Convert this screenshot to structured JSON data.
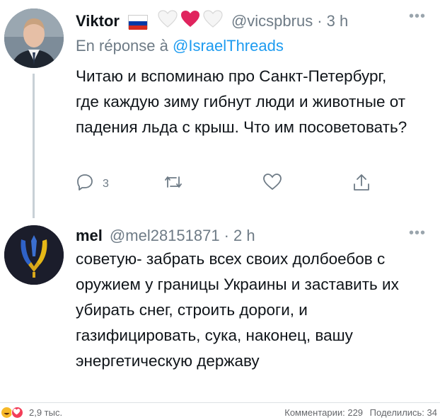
{
  "tweets": [
    {
      "author_name": "Viktor",
      "handle": "@vicspbrus",
      "time": "· 3 h",
      "reply_prefix": "En réponse à",
      "reply_to": "@IsraelThreads",
      "text": "Читаю и вспоминаю про Санкт-Петербург, где каждую зиму гибнут люди и животные от падения льда с крыш. Что им посоветовать?",
      "reply_count": "3",
      "icons": [
        "flag-russia-icon",
        "white-heart-icon",
        "red-heart-icon",
        "white-heart-icon",
        "more-icon",
        "reply-icon",
        "retweet-icon",
        "like-icon",
        "share-icon"
      ]
    },
    {
      "author_name": "mel",
      "handle": "@mel28151871",
      "time": "· 2 h",
      "text": "советую- забрать всех своих долбоебов с оружием у границы Украины и заставить их убирать снег, строить дороги, и газифицировать, сука, наконец, вашу энергетическую державу",
      "icons": [
        "ukraine-trident-avatar-icon",
        "more-icon"
      ]
    }
  ],
  "footer": {
    "reactions_count": "2,9 тыс.",
    "comments": "Комментарии: 229",
    "shares": "Поделились: 34"
  },
  "colors": {
    "link": "#1d9bf0",
    "muted": "#6e7b86",
    "heart": "#e0245e",
    "flag_red": "#d52b1e",
    "flag_blue": "#0039a6"
  }
}
